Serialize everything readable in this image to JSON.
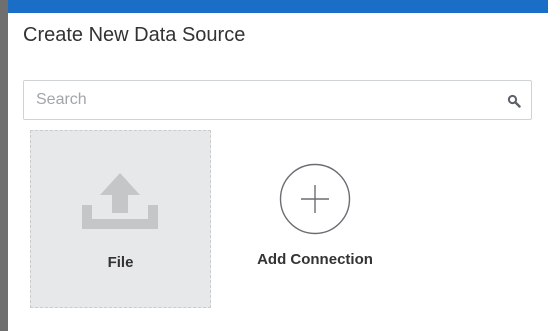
{
  "dialog": {
    "title": "Create New Data Source",
    "accent_color": "#1a6ec5"
  },
  "search": {
    "placeholder": "Search",
    "value": "",
    "icon": "search-icon"
  },
  "tiles": [
    {
      "label": "File",
      "icon": "upload-icon"
    },
    {
      "label": "Add Connection",
      "icon": "plus-circle-icon"
    }
  ]
}
